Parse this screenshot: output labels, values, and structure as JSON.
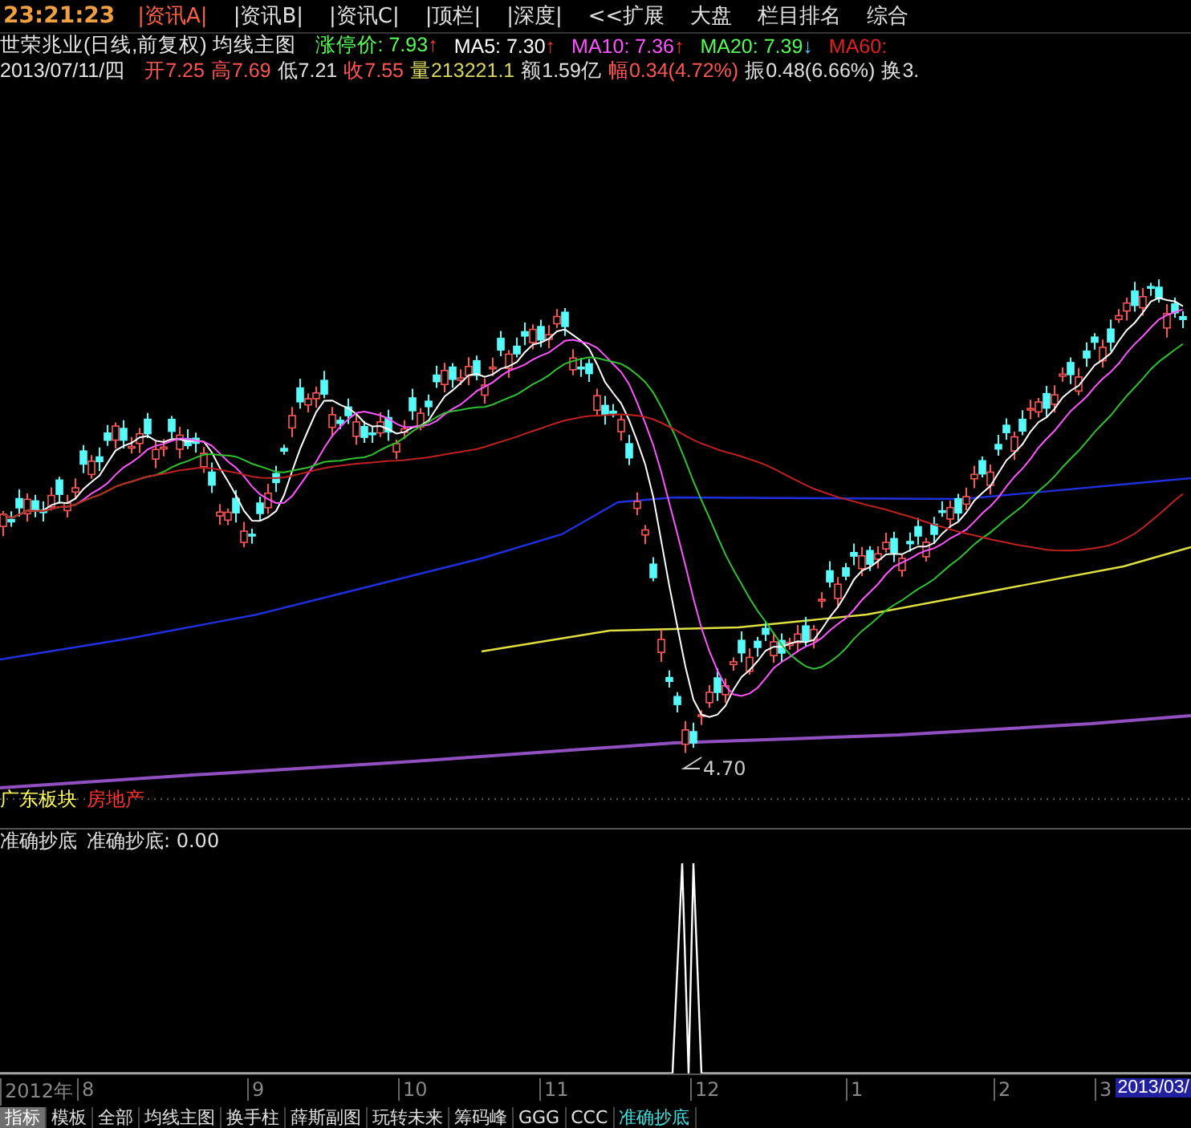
{
  "top_bar": {
    "clock": "23:21:23",
    "tabs": [
      {
        "label": "|资讯A|",
        "selected": true
      },
      {
        "label": "|资讯B|",
        "selected": false
      },
      {
        "label": "|资讯C|",
        "selected": false
      },
      {
        "label": "|顶栏|",
        "selected": false
      },
      {
        "label": "|深度|",
        "selected": false
      },
      {
        "label": "<<扩展",
        "selected": false
      },
      {
        "label": "大盘",
        "selected": false
      },
      {
        "label": "栏目排名",
        "selected": false
      },
      {
        "label": "综合",
        "selected": false
      }
    ]
  },
  "stock_line": {
    "title": "世荣兆业(日线,前复权) 均线主图",
    "indicators": [
      {
        "label": "涨停价: ",
        "value": "7.93",
        "trend": "↑",
        "color": "#54fc54"
      },
      {
        "label": "MA5: ",
        "value": "7.30",
        "trend": "↑",
        "color": "#ffffff"
      },
      {
        "label": "MA10: ",
        "value": "7.36",
        "trend": "↑",
        "color": "#ff54ff"
      },
      {
        "label": "MA20: ",
        "value": "7.39",
        "trend": "↓",
        "color": "#54fc54"
      },
      {
        "label": "MA60: ",
        "color": "#e02020"
      }
    ]
  },
  "quote_line": {
    "date": "2013/07/11/四",
    "items": [
      {
        "label": "开",
        "value": "7.25",
        "color": "#ff5454"
      },
      {
        "label": "高",
        "value": "7.69",
        "color": "#ff5454"
      },
      {
        "label": "低",
        "value": "7.21",
        "color": "#e0e0e0"
      },
      {
        "label": "收",
        "value": "7.55",
        "color": "#ff5454"
      },
      {
        "label": "量",
        "value": "213221.1",
        "color": "#d8d860"
      },
      {
        "label": "额",
        "value": "1.59亿",
        "color": "#e0e0e0"
      },
      {
        "label": "幅",
        "value": "0.34(4.72%)",
        "color": "#ff5454"
      },
      {
        "label": "振",
        "value": "0.48(6.66%)",
        "color": "#e0e0e0"
      },
      {
        "label": "换",
        "value": "3.",
        "color": "#e0e0e0"
      }
    ]
  },
  "main_chart": {
    "low_label": "4.70",
    "sectors": [
      {
        "label": "广东板块",
        "color": "#ffff54"
      },
      {
        "label": "房地产",
        "color": "#ff3030"
      }
    ]
  },
  "sub_chart": {
    "title": "准确抄底",
    "reading": "准确抄底: 0.00"
  },
  "time_axis": {
    "labels": [
      "2012年",
      "8",
      "9",
      "10",
      "11",
      "12",
      "1",
      "2",
      "3"
    ],
    "cursor": "2013/03/"
  },
  "bottom_tabs": [
    {
      "label": "指标",
      "selected": true,
      "current": false
    },
    {
      "label": "模板",
      "selected": false,
      "current": false
    },
    {
      "label": "全部",
      "selected": false,
      "current": false
    },
    {
      "label": "均线主图",
      "selected": false,
      "current": false
    },
    {
      "label": "换手柱",
      "selected": false,
      "current": false
    },
    {
      "label": "薛斯副图",
      "selected": false,
      "current": false
    },
    {
      "label": "玩转未来",
      "selected": false,
      "current": false
    },
    {
      "label": "筹码峰",
      "selected": false,
      "current": false
    },
    {
      "label": "GGG",
      "selected": false,
      "current": false
    },
    {
      "label": "CCC",
      "selected": false,
      "current": false
    },
    {
      "label": "准确抄底",
      "selected": false,
      "current": true
    }
  ]
}
